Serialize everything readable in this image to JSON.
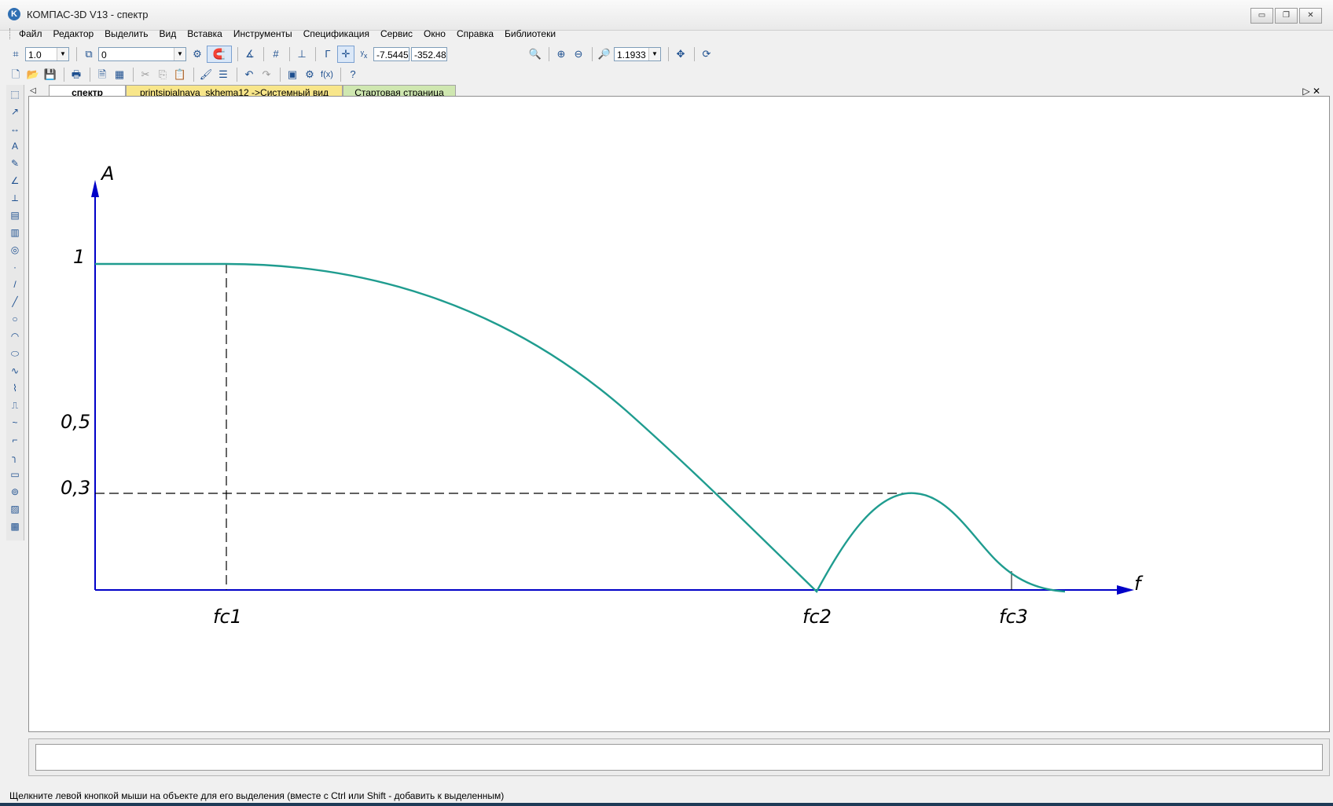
{
  "window": {
    "title": "КОМПАС-3D V13 - спектр",
    "buttons": {
      "minimize": "▭",
      "restore": "❐",
      "close": "✕"
    }
  },
  "menu": [
    "Файл",
    "Редактор",
    "Выделить",
    "Вид",
    "Вставка",
    "Инструменты",
    "Спецификация",
    "Сервис",
    "Окно",
    "Справка",
    "Библиотеки"
  ],
  "toolbar1": {
    "scale_value": "1.0",
    "layer_value": "0",
    "coord_x": "-7.5445",
    "coord_y": "-352.48",
    "zoom_value": "1.1933"
  },
  "tabs": [
    "спектр",
    "printsipialnaya_skhema12 ->Системный вид",
    "Стартовая страница"
  ],
  "drawing": {
    "y_axis_label": "A",
    "x_axis_label": "f",
    "y_ticks": [
      "1",
      "0,5",
      "0,3"
    ],
    "x_ticks": [
      "fc1",
      "fc2",
      "fc3"
    ]
  },
  "status_text": "Щелкните левой кнопкой мыши на объекте для его выделения (вместе с Ctrl или Shift - добавить к выделенным)",
  "colors": {
    "axis": "#0000c8",
    "curve": "#1f9c8f",
    "dash": "#000000"
  }
}
